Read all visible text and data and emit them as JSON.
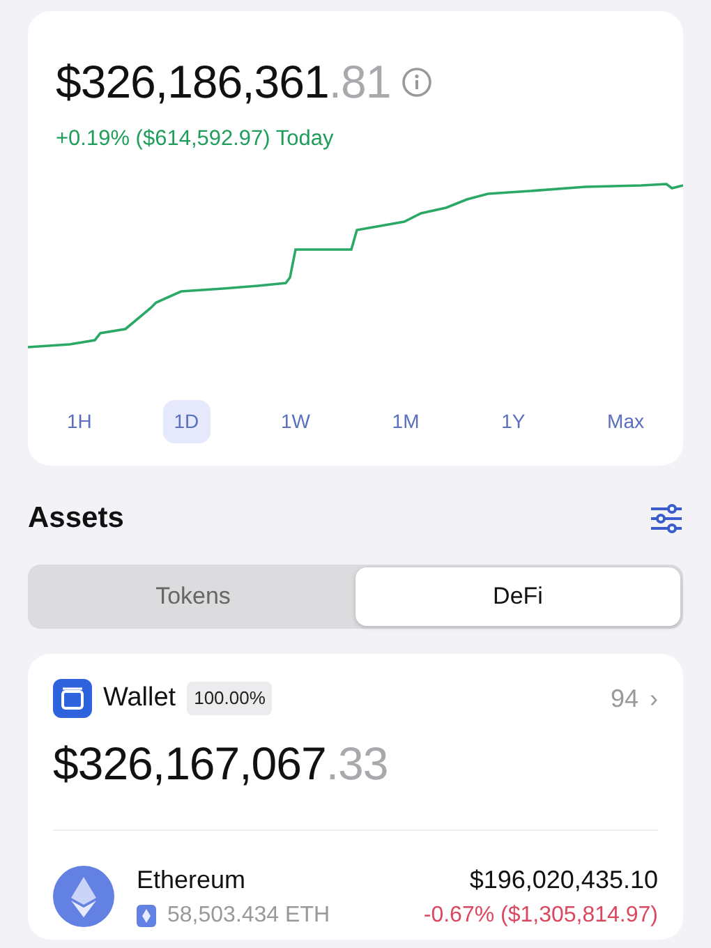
{
  "balance": {
    "whole": "$326,186,361",
    "fraction": ".81",
    "change": "+0.19% ($614,592.97) Today",
    "kind": "gain"
  },
  "ranges": [
    {
      "label": "1H",
      "selected": false
    },
    {
      "label": "1D",
      "selected": true
    },
    {
      "label": "1W",
      "selected": false
    },
    {
      "label": "1M",
      "selected": false
    },
    {
      "label": "1Y",
      "selected": false
    },
    {
      "label": "Max",
      "selected": false
    }
  ],
  "assets": {
    "title": "Assets",
    "segments": [
      {
        "label": "Tokens",
        "selected": false
      },
      {
        "label": "DeFi",
        "selected": true
      }
    ]
  },
  "wallet": {
    "name": "Wallet",
    "share": "100.00%",
    "count": "94",
    "chevron": "›",
    "whole": "$326,167,067",
    "fraction": ".33",
    "tokens": [
      {
        "name": "Ethereum",
        "amount": "58,503.434 ETH",
        "value": "$196,020,435.10",
        "change": "-0.67% ($1,305,814.97)",
        "kind": "loss"
      }
    ]
  }
}
